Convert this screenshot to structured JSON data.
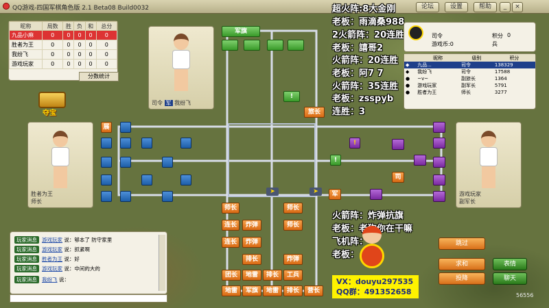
{
  "window": {
    "title": "QQ游戏-四国军棋角色版 2.1 Beta08 Build0032",
    "buttons": [
      "论坛",
      "设置",
      "帮助"
    ]
  },
  "score_table": {
    "headers": [
      "昵称",
      "局数",
      "胜",
      "负",
      "和",
      "总分"
    ],
    "rows": [
      {
        "name": "九品小麻",
        "cells": [
          "0",
          "0",
          "0",
          "0",
          "0"
        ],
        "highlight": true
      },
      {
        "name": "胜者为王",
        "cells": [
          "0",
          "0",
          "0",
          "0",
          "0"
        ],
        "highlight": false
      },
      {
        "name": "我纷飞",
        "cells": [
          "0",
          "0",
          "0",
          "0",
          "0"
        ],
        "highlight": false
      },
      {
        "name": "游戏玩家",
        "cells": [
          "0",
          "0",
          "0",
          "0",
          "0"
        ],
        "highlight": false
      }
    ],
    "tab": "分数统计"
  },
  "players": {
    "top": {
      "rank": "司令",
      "name": "我纷飞"
    },
    "left": {
      "rank": "师长",
      "name": "胜者为王"
    },
    "right": {
      "name": "游戏玩家",
      "rank": "副军长"
    }
  },
  "chest_label": "夺宝",
  "overlay_right": [
    "超火阵:8大金刚",
    "老板：雨滴桑988",
    "2火箭阵：20连胜",
    "老板：譆哥2",
    "火箭阵：20连胜",
    "老板：阿7   7",
    "火箭阵：35连胜",
    "老板：zsspyb",
    "连胜：3"
  ],
  "overlay_bottom": [
    "火箭阵：炸弹抗旗",
    "老板：老狗你在干嘛",
    "飞机阵：",
    "老板："
  ],
  "vx": {
    "line1": "VX：douyu297535",
    "line2": "QQ群：491352658"
  },
  "self_info": {
    "rank": "司令",
    "coins_label": "游戏币:0",
    "score_label": "积分",
    "score_value": "0",
    "level_label": "兵"
  },
  "player_list": {
    "headers": [
      "昵称",
      "级别",
      "积分"
    ],
    "rows": [
      {
        "name": "九品...",
        "level": "司令",
        "score": "138329",
        "selected": true
      },
      {
        "name": "我纷飞",
        "level": "司令",
        "score": "17588",
        "selected": false
      },
      {
        "name": "~v~",
        "level": "副旅长",
        "score": "1364",
        "selected": false
      },
      {
        "name": "游戏玩家",
        "level": "副军长",
        "score": "5791",
        "selected": false
      },
      {
        "name": "胜者为王",
        "level": "师长",
        "score": "3277",
        "selected": false
      }
    ]
  },
  "chat": {
    "lines": [
      {
        "tag": "玩家消息",
        "who": "游戏玩家",
        "text": "说：够本了 防守家里"
      },
      {
        "tag": "玩家消息",
        "who": "游戏玩家",
        "text": "说：抓紧啊"
      },
      {
        "tag": "玩家消息",
        "who": "胜者为王",
        "text": "说：好"
      },
      {
        "tag": "玩家消息",
        "who": "游戏玩家",
        "text": "说：中间的大的"
      },
      {
        "tag": "玩家消息",
        "who": "我纷飞",
        "text": "说："
      }
    ]
  },
  "actions": {
    "skip": "跳过",
    "peace": "求和",
    "surrender": "投降",
    "emoji": "表情",
    "chat": "聊天"
  },
  "board": {
    "top_pieces": [
      {
        "label": "军旗",
        "row": 0,
        "col": 1
      },
      {
        "label": "!",
        "row": 4,
        "col": 3
      },
      {
        "label": "旅长",
        "row": 5,
        "col": 4
      }
    ],
    "bottom_pieces": [
      {
        "label": "师长",
        "row": 0,
        "col": 0
      },
      {
        "label": "师长",
        "row": 0,
        "col": 3
      },
      {
        "label": "连长",
        "row": 1,
        "col": 0
      },
      {
        "label": "炸弹",
        "row": 1,
        "col": 1
      },
      {
        "label": "师长",
        "row": 1,
        "col": 3
      },
      {
        "label": "连长",
        "row": 2,
        "col": 0
      },
      {
        "label": "炸弹",
        "row": 2,
        "col": 1
      },
      {
        "label": "排长",
        "row": 3,
        "col": 1
      },
      {
        "label": "炸弹",
        "row": 3,
        "col": 3
      },
      {
        "label": "团长",
        "row": 4,
        "col": 0
      },
      {
        "label": "地雷",
        "row": 4,
        "col": 1
      },
      {
        "label": "排长",
        "row": 4,
        "col": 2
      },
      {
        "label": "工兵",
        "row": 4,
        "col": 3
      },
      {
        "label": "地雷",
        "row": 5,
        "col": 0
      },
      {
        "label": "军旗",
        "row": 5,
        "col": 1
      },
      {
        "label": "地雷",
        "row": 5,
        "col": 2
      },
      {
        "label": "排长",
        "row": 5,
        "col": 3
      },
      {
        "label": "营长",
        "row": 5,
        "col": 4
      }
    ],
    "left_pieces": [
      {
        "label": "展"
      }
    ],
    "right_pieces": [
      {
        "label": "司"
      },
      {
        "label": "军"
      },
      {
        "label": "!"
      },
      {
        "label": "!"
      }
    ]
  },
  "footer_number": "56556",
  "colors": {
    "panel": "#f4f1e6",
    "accent_orange": "#d96a14",
    "overlay_text": "#ffffff",
    "vx_bg": "#fff200"
  }
}
